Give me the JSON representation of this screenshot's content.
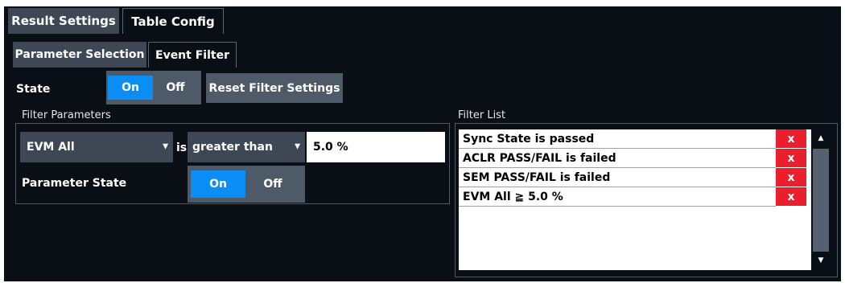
{
  "tabs_top": {
    "result_settings": "Result Settings",
    "table_config": "Table Config"
  },
  "tabs_sub": {
    "parameter_selection": "Parameter Selection",
    "event_filter": "Event Filter"
  },
  "state": {
    "label": "State",
    "on": "On",
    "off": "Off",
    "selected": "On"
  },
  "reset_button": "Reset Filter Settings",
  "filter_parameters": {
    "title": "Filter Parameters",
    "parameter": "EVM All",
    "is_label": "is",
    "operator": "greater than",
    "value": "5.0 %",
    "parameter_state": {
      "label": "Parameter State",
      "on": "On",
      "off": "Off",
      "selected": "On"
    }
  },
  "filter_list": {
    "title": "Filter List",
    "items": [
      {
        "text": "Sync State is passed",
        "delete": "x"
      },
      {
        "text": "ACLR PASS/FAIL is failed",
        "delete": "x"
      },
      {
        "text": "SEM PASS/FAIL is failed",
        "delete": "x"
      },
      {
        "text": "EVM All ≧ 5.0 %",
        "delete": "x"
      }
    ]
  },
  "icons": {
    "dropdown": "chevron-down-icon",
    "scroll_up": "scroll-up-icon",
    "scroll_down": "scroll-down-icon"
  },
  "colors": {
    "accent": "#0a8ef6",
    "delete": "#ea1e2c",
    "background": "#0a0e15"
  }
}
